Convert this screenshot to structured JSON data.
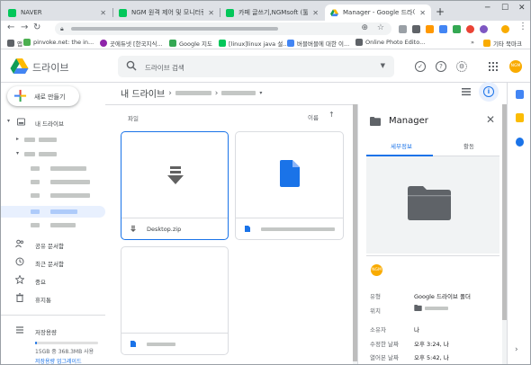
{
  "browser": {
    "tabs": [
      {
        "title": "NAVER",
        "color": "#03c75a"
      },
      {
        "title": "NGM 원격 제어 및 모니터링 프",
        "color": "#03c75a"
      },
      {
        "title": "카페 글쓰기,NGMsoft (툴개발 프",
        "color": "#03c75a"
      },
      {
        "title": "Manager - Google 드라이브",
        "color": "#1a73e8"
      }
    ],
    "new_tab": "+",
    "window_controls": [
      "─",
      "☐",
      "✕"
    ],
    "nav": {
      "back": "←",
      "forward": "→",
      "reload": "↻",
      "home": "⌂"
    },
    "omnibox": {
      "zoom": "⊕",
      "star": "☆"
    },
    "bookmarks": [
      {
        "label": "앱",
        "color": "#5f6368"
      },
      {
        "label": "pinvoke.net: the in...",
        "color": "#4caf50"
      },
      {
        "label": "곳에듀넷 [한국지식...",
        "color": "#8e24aa"
      },
      {
        "label": "Google 지도",
        "color": "#34a853"
      },
      {
        "label": "[linux]linux java 설...",
        "color": "#03c75a"
      },
      {
        "label": "버블버블에 대한 이...",
        "color": "#4285f4"
      },
      {
        "label": "Online Photo Edito...",
        "color": "#5f6368"
      }
    ],
    "bookmarks_more": "»",
    "other_bookmarks": "기타 북마크"
  },
  "drive": {
    "brand": "드라이브",
    "search_placeholder": "드라이브 검색",
    "search_options": "▼",
    "new_button": "새로 만들기",
    "my_drive": "내 드라이브",
    "nav_items": [
      "공유 문서함",
      "최근 문서함",
      "중요",
      "휴지통"
    ],
    "storage_label": "저장용량",
    "storage_used": "15GB 중 368.3MB 사용",
    "storage_fraction": 0.024,
    "storage_upgrade": "저장용량 업그레이드",
    "breadcrumb_root": "내 드라이브",
    "breadcrumb_sep": "›",
    "section_label": "파일",
    "sort_label": "이름",
    "sort_arrow": "↑",
    "files": [
      {
        "name": "Desktop.zip"
      }
    ],
    "avatar_text": "NGM"
  },
  "details": {
    "title": "Manager",
    "close": "✕",
    "tabs": [
      "세부정보",
      "활동"
    ],
    "fields": [
      {
        "key": "유형",
        "value": "Google 드라이브 폴더"
      },
      {
        "key": "위치",
        "value": ""
      },
      {
        "key": "소유자",
        "value": "나"
      },
      {
        "key": "수정한 날짜",
        "value": "오후 3:24, 나"
      },
      {
        "key": "열어본 날짜",
        "value": "오후 5:42, 나"
      }
    ]
  },
  "colors": {
    "accent": "#1a73e8",
    "selected_bg": "#e8f0fe",
    "avatar": "#f9ab00"
  },
  "rail": {
    "expand": "›"
  }
}
